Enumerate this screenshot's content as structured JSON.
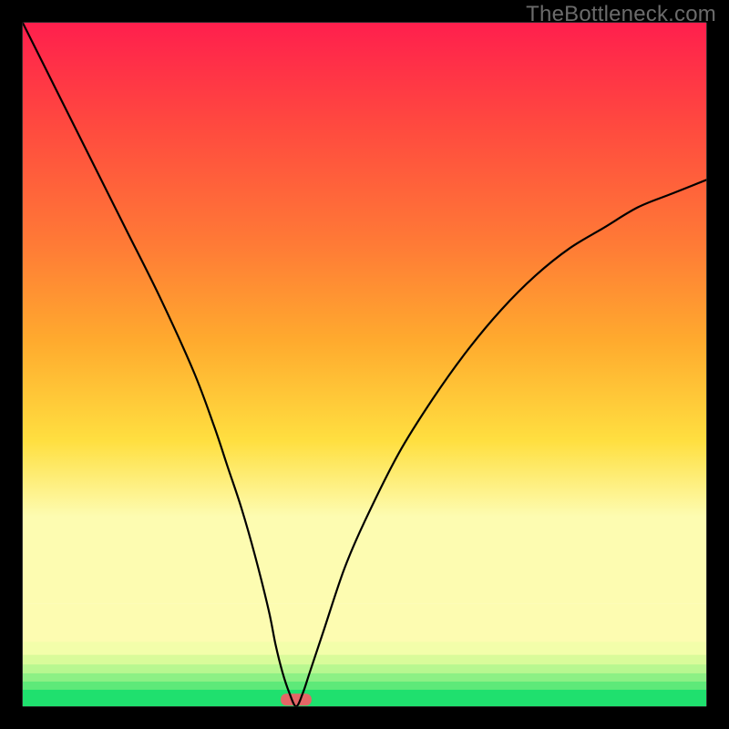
{
  "watermark": "TheBottleneck.com",
  "chart_data": {
    "type": "line",
    "title": "",
    "xlabel": "",
    "ylabel": "",
    "xlim": [
      0,
      100
    ],
    "ylim": [
      0,
      100
    ],
    "series": [
      {
        "name": "bottleneck-curve",
        "x": [
          0,
          5,
          10,
          15,
          20,
          25,
          28,
          30,
          32,
          34,
          36,
          37,
          38,
          39,
          40,
          41,
          42,
          44,
          47,
          50,
          55,
          60,
          65,
          70,
          75,
          80,
          85,
          90,
          95,
          100
        ],
        "y": [
          100,
          90,
          80,
          70,
          60,
          49,
          41,
          35,
          29,
          22,
          14,
          9,
          5,
          2,
          0,
          2,
          5,
          11,
          20,
          27,
          37,
          45,
          52,
          58,
          63,
          67,
          70,
          73,
          75,
          77
        ]
      }
    ],
    "minimum_marker": {
      "x": 40,
      "y": 0,
      "width_pct": 4.5,
      "color": "#e36666"
    },
    "frame": {
      "left_pct": 3.1,
      "top_pct": 3.1,
      "right_pct": 96.9,
      "bottom_pct": 96.9
    },
    "bands": [
      {
        "y0": 97.5,
        "y1": 100,
        "color": "#1fe06e"
      },
      {
        "y0": 96.3,
        "y1": 97.5,
        "color": "#5ee979"
      },
      {
        "y0": 95.1,
        "y1": 96.3,
        "color": "#8df085"
      },
      {
        "y0": 93.8,
        "y1": 95.1,
        "color": "#b8f790"
      },
      {
        "y0": 92.4,
        "y1": 93.8,
        "color": "#d9fb9a"
      },
      {
        "y0": 90.5,
        "y1": 92.4,
        "color": "#f3feaa"
      },
      {
        "y0": 85.0,
        "y1": 90.5,
        "color": "#fdfcb1"
      }
    ],
    "gradient_stops": [
      {
        "offset": 0.0,
        "color": "#ff1f4d"
      },
      {
        "offset": 0.18,
        "color": "#ff4a3f"
      },
      {
        "offset": 0.38,
        "color": "#ff7a36"
      },
      {
        "offset": 0.55,
        "color": "#ffab2e"
      },
      {
        "offset": 0.72,
        "color": "#ffdf40"
      },
      {
        "offset": 0.85,
        "color": "#fdfcb1"
      }
    ]
  }
}
